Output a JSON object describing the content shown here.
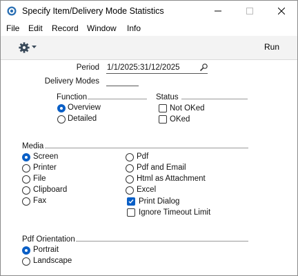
{
  "window": {
    "title": "Specify Item/Delivery Mode Statistics"
  },
  "menu": [
    "File",
    "Edit",
    "Record",
    "Window",
    "Info"
  ],
  "toolbar": {
    "run_label": "Run"
  },
  "period": {
    "label": "Period",
    "value": "1/1/2025:31/12/2025"
  },
  "delivery_modes": {
    "label": "Delivery Modes",
    "value": ""
  },
  "function": {
    "label": "Function",
    "options": [
      {
        "label": "Overview",
        "selected": true
      },
      {
        "label": "Detailed",
        "selected": false
      }
    ]
  },
  "status": {
    "label": "Status",
    "options": [
      {
        "label": "Not OKed",
        "checked": false
      },
      {
        "label": "OKed",
        "checked": false
      }
    ]
  },
  "media": {
    "label": "Media",
    "left_options": [
      {
        "label": "Screen",
        "selected": true
      },
      {
        "label": "Printer",
        "selected": false
      },
      {
        "label": "File",
        "selected": false
      },
      {
        "label": "Clipboard",
        "selected": false
      },
      {
        "label": "Fax",
        "selected": false
      }
    ],
    "right_options": [
      {
        "label": "Pdf",
        "selected": false
      },
      {
        "label": "Pdf and Email",
        "selected": false
      },
      {
        "label": "Html as Attachment",
        "selected": false
      },
      {
        "label": "Excel",
        "selected": false
      }
    ],
    "checkboxes": [
      {
        "label": "Print Dialog",
        "checked": true
      },
      {
        "label": "Ignore Timeout Limit",
        "checked": false
      }
    ]
  },
  "pdf_orientation": {
    "label": "Pdf Orientation",
    "options": [
      {
        "label": "Portrait",
        "selected": true
      },
      {
        "label": "Landscape",
        "selected": false
      }
    ]
  },
  "colors": {
    "accent": "#0a5fc6",
    "toolbar_bg": "#f3f3f3"
  }
}
